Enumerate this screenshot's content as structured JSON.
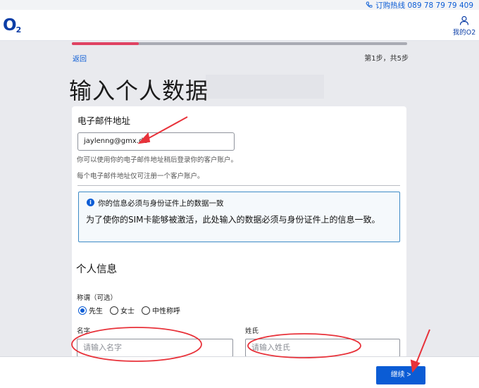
{
  "top_bar": {
    "hotline": "订购热线 089 78 79 79 409"
  },
  "header": {
    "logo_main": "O",
    "logo_sub": "2",
    "account_label": "我的O2"
  },
  "progress": {
    "fraction": 0.2,
    "back_label": "返回",
    "step_text": "第1步，共5步"
  },
  "page": {
    "title": "输入个人数据"
  },
  "email_section": {
    "label": "电子邮件地址",
    "value": "jaylenng@gmx.de",
    "hint1": "你可以使用你的电子邮件地址稍后登录你的客户账户。",
    "hint2": "每个电子邮件地址仅可注册一个客户账户。"
  },
  "info_box": {
    "heading": "你的信息必须与身份证件上的数据一致",
    "body": "为了使你的SIM卡能够被激活，此处输入的数据必须与身份证件上的信息一致。"
  },
  "personal": {
    "heading": "个人信息",
    "salutation_label": "称谓（可选）",
    "salutations": [
      "先生",
      "女士",
      "中性称呼"
    ],
    "selected_salutation": "先生",
    "first_name_label": "名字",
    "first_name_placeholder": "请输入名字",
    "last_name_label": "姓氏",
    "last_name_placeholder": "请输入姓氏"
  },
  "footer": {
    "continue_label": "继续 >"
  },
  "colors": {
    "accent": "#0b5cd5",
    "progress": "#e04362",
    "annotation": "#e8323a"
  }
}
